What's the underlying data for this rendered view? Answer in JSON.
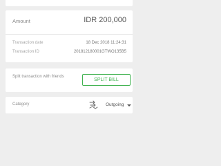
{
  "transaction": {
    "amount_label": "Amount",
    "amount_value": "IDR 200,000",
    "date_label": "Transaction date",
    "date_value": "18 Dec 2018 11:24:31",
    "id_label": "Transaction ID",
    "id_value": "20181218000​1GTWO135B5"
  },
  "split": {
    "text": "Split transaction with friends",
    "button_label": "SPLIT BILL"
  },
  "category": {
    "label": "Category",
    "value": "Outgoing",
    "icon": "outgoing-transfer-icon"
  },
  "colors": {
    "accent": "#3fb24f",
    "background": "#eeeeee",
    "card": "#ffffff"
  }
}
